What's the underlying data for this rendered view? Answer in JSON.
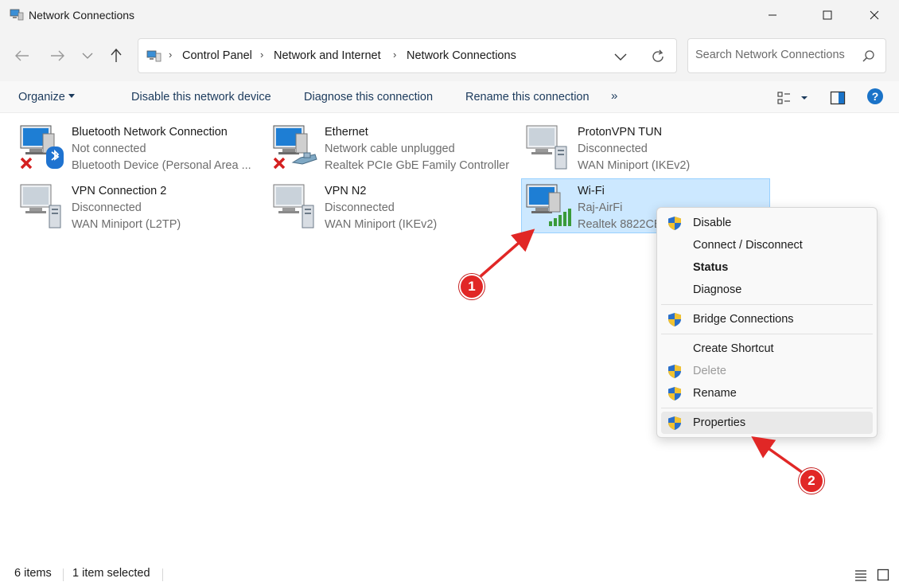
{
  "window": {
    "title": "Network Connections"
  },
  "breadcrumb": [
    "Control Panel",
    "Network and Internet",
    "Network Connections"
  ],
  "search": {
    "placeholder": "Search Network Connections"
  },
  "commands": {
    "organize": "Organize",
    "disable": "Disable this network device",
    "diagnose": "Diagnose this connection",
    "rename": "Rename this connection",
    "more": "»"
  },
  "items": [
    {
      "name": "Bluetooth Network Connection",
      "status": "Not connected",
      "device": "Bluetooth Device (Personal Area ...",
      "icon": "bluetooth-network-icon"
    },
    {
      "name": "Ethernet",
      "status": "Network cable unplugged",
      "device": "Realtek PCIe GbE Family Controller",
      "icon": "ethernet-network-icon"
    },
    {
      "name": "ProtonVPN TUN",
      "status": "Disconnected",
      "device": "WAN Miniport (IKEv2)",
      "icon": "vpn-network-icon"
    },
    {
      "name": "VPN Connection 2",
      "status": "Disconnected",
      "device": "WAN Miniport (L2TP)",
      "icon": "vpn-network-icon"
    },
    {
      "name": "VPN N2",
      "status": "Disconnected",
      "device": "WAN Miniport (IKEv2)",
      "icon": "vpn-network-icon"
    },
    {
      "name": "Wi-Fi",
      "status": "Raj-AirFi",
      "device": "Realtek 8822CE",
      "icon": "wifi-network-icon",
      "selected": true
    }
  ],
  "context_menu": [
    {
      "label": "Disable",
      "shield": true
    },
    {
      "label": "Connect / Disconnect",
      "shield": false
    },
    {
      "label": "Status",
      "shield": false,
      "bold": true
    },
    {
      "label": "Diagnose",
      "shield": false
    },
    {
      "label": "Bridge Connections",
      "shield": true
    },
    {
      "label": "Create Shortcut",
      "shield": false
    },
    {
      "label": "Delete",
      "shield": true,
      "disabled": true
    },
    {
      "label": "Rename",
      "shield": true
    },
    {
      "label": "Properties",
      "shield": true,
      "highlighted": true
    }
  ],
  "annotations": {
    "badge1": "1",
    "badge2": "2"
  },
  "status": {
    "count": "6 items",
    "selection": "1 item selected"
  },
  "colors": {
    "accent": "#0067c0",
    "selection": "#cce8ff",
    "annotation": "#e12726"
  }
}
